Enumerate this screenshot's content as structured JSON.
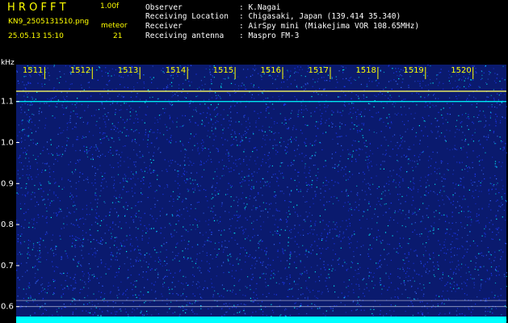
{
  "header": {
    "logo": "H R O F F T",
    "version": "1.00f",
    "filename": "KN9_2505131510.png",
    "mode": "meteor",
    "datetime": "25.05.13 15:10",
    "count": "21",
    "info": [
      {
        "label": "Observer",
        "value": ": K.Nagai"
      },
      {
        "label": "Receiving Location",
        "value": ": Chigasaki, Japan (139.414 35.340)"
      },
      {
        "label": "Receiver",
        "value": ": AirSpy mini (Miakejima VOR 108.65MHz)"
      },
      {
        "label": "Receiving antenna",
        "value": ": Maspro FM-3"
      }
    ]
  },
  "colors": {
    "background": "#000000",
    "header_text": "#ffffff",
    "accent_text": "#ffff00",
    "waterfall_low": "#0a1a6e",
    "waterfall_mid": "#1e3cff",
    "waterfall_high": "#00ffff",
    "line_yellow": "#ffff60"
  },
  "chart_data": {
    "type": "heatmap",
    "title": "",
    "xlabel": "",
    "ylabel": "kHz",
    "x_ticks": [
      "1511",
      "1512",
      "1513",
      "1514",
      "1515",
      "1516",
      "1517",
      "1518",
      "1519",
      "1520"
    ],
    "y_ticks": [
      {
        "label": "1.1",
        "value": 1.1
      },
      {
        "label": "1.0",
        "value": 1.0
      },
      {
        "label": "0.9",
        "value": 0.9
      },
      {
        "label": "0.8",
        "value": 0.8
      },
      {
        "label": "0.7",
        "value": 0.7
      },
      {
        "label": "0.6",
        "value": 0.6
      }
    ],
    "ylim": [
      0.56,
      1.19
    ],
    "xlim_minutes": [
      1510.4,
      1520.7
    ],
    "horizontal_lines_khz": [
      1.125,
      1.1,
      0.615,
      0.6
    ],
    "grid": false
  }
}
